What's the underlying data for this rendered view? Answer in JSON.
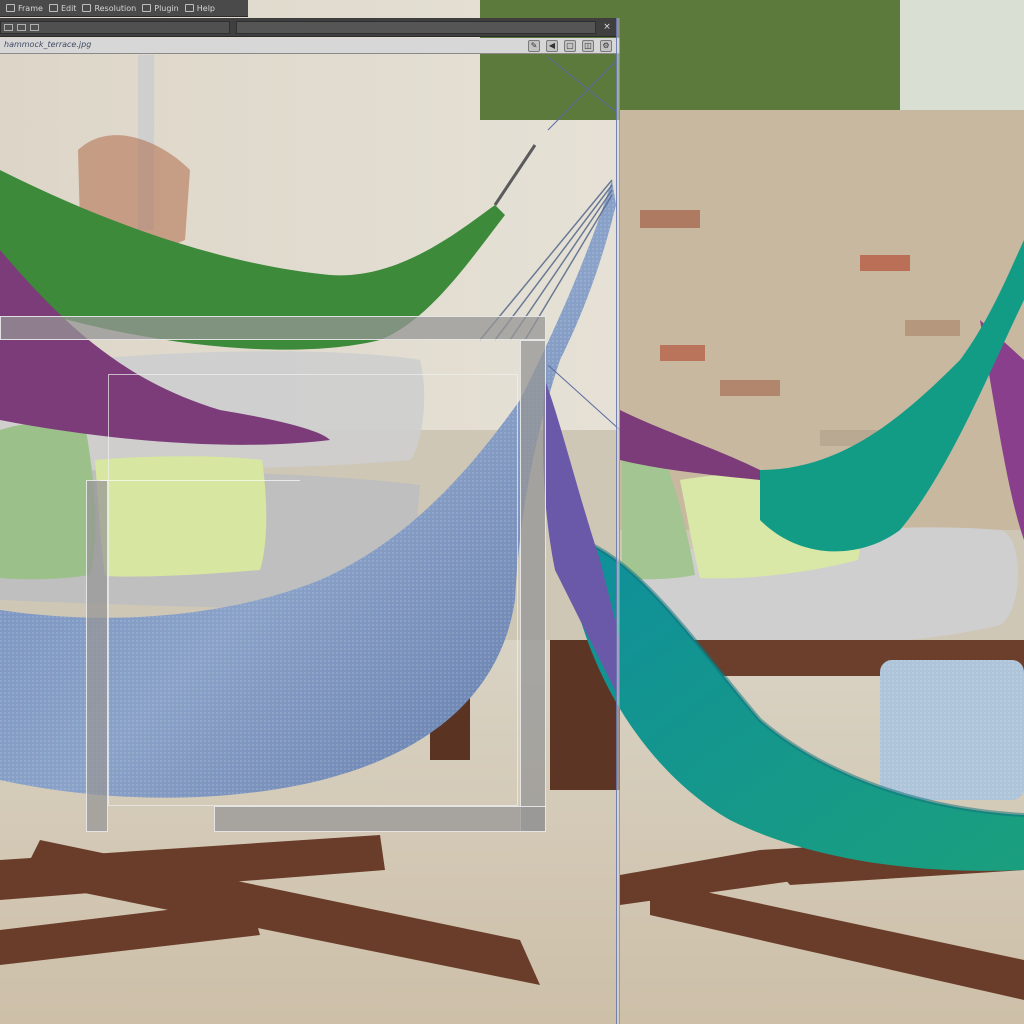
{
  "menu": {
    "items": [
      {
        "label": "Frame",
        "icon": "square-icon"
      },
      {
        "label": "Edit",
        "icon": "square-icon"
      },
      {
        "label": "Resolution",
        "icon": "square-icon"
      },
      {
        "label": "Plugin",
        "icon": "square-icon"
      },
      {
        "label": "Help",
        "icon": "square-icon"
      }
    ]
  },
  "window": {
    "close_glyph": "×",
    "document_title": "hammock_terrace.jpg",
    "tool_icons": [
      "pen-icon",
      "triangle-icon",
      "square-icon",
      "layers-icon",
      "settings-icon"
    ],
    "tool_glyphs": [
      "✎",
      "◀",
      "▢",
      "◫",
      "⚙"
    ]
  },
  "palette": {
    "wall": "#d8d2c4",
    "stone_wall": "#c9b9a2",
    "brick": "#b4644a",
    "ground": "#d9d1bf",
    "wood": "#6a3d2a",
    "green_hammock": "#3c8a3a",
    "teal_hammock": "#139a8c",
    "purple_hammock": "#7b3c79",
    "blue_hammock": "#6f89b8",
    "cushion_gray": "#cfcfcf",
    "pillow_lime": "#d7e6a0",
    "pillow_green": "#9cc08a",
    "foliage": "#4f6a35"
  }
}
